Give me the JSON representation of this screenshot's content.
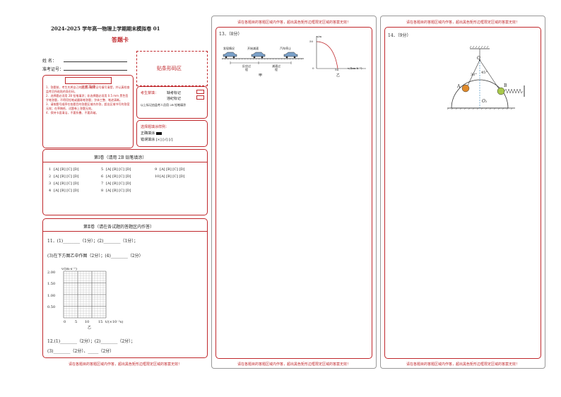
{
  "header": {
    "title": "2024-2025 学年高一物理上学期期末模拟卷 01",
    "subtitle": "答题卡"
  },
  "candidate": {
    "name_label": "姓 名：",
    "id_label": "准考证号：",
    "barcode_label": "贴条形码区"
  },
  "notes": {
    "title": "注意事项",
    "items": [
      "1．答题前，考生先将自己的姓名，准考证号填写清楚，并认真检查监考员所粘贴的条形码。",
      "2．选择题必须用 2B 铅笔填涂；非选择题必须用 0.5 mm 黑色签字笔答题，不得用铅笔或圆珠笔答题；字体工整、笔迹清晰。",
      "3．请按题号顺序在各题目的答题区域内作答，超出区域书写的答案无效；在草稿纸、试题卷上答题无效。",
      "4．保持卡面清洁，不要折叠、不要弄破。"
    ]
  },
  "exam_marks": {
    "label": "考生禁填：",
    "absent": "缺考标记",
    "violation": "违纪标记",
    "note": "以上标记由监考人员用 2B 铅笔填涂"
  },
  "fill_example": {
    "title": "选择题填涂样例：",
    "correct": "正确填涂",
    "wrong": "错误填涂",
    "wrong_marks": "[×] [√] [/]"
  },
  "section1": {
    "title": "第Ⅰ卷（请用 2B 铅笔填涂）",
    "options": "[A] [B] [C] [D]",
    "numbers": [
      "1",
      "2",
      "3",
      "4",
      "5",
      "6",
      "7",
      "8",
      "9",
      "10"
    ]
  },
  "section2": {
    "title": "第Ⅱ卷（请在各试题的答题区内作答）",
    "q11_line1": "11．(1)________（1分）；(2)________（1分）；",
    "q11_line2": "(3)在下方图乙中作图（2分）；(4)________（2分）",
    "graph": {
      "ylabel": "v/(m·s⁻¹)",
      "xlabel": "t/(×10⁻²s)",
      "caption": "乙",
      "y_ticks": [
        "2.00",
        "1.50",
        "1.00",
        "0.50"
      ],
      "x_ticks": [
        "0",
        "5",
        "10",
        "15"
      ]
    },
    "q12_line1": "12.(1)________（2分）；(2)________（2分）；",
    "q12_line2": "(3)________（2分）、_____（2分）"
  },
  "q13": {
    "label": "13．（8分）",
    "phases": [
      "发现情况",
      "开始减速",
      "汽车停止"
    ],
    "sub": [
      "反应过程",
      "减速过程"
    ],
    "caption_left": "甲",
    "caption_right": "乙",
    "v_axis": "v/(km·h⁻¹)",
    "s_axis": "s/m",
    "s_val": "50",
    "v_val": "54",
    "origin": "0"
  },
  "q14": {
    "label": "14．（9分）",
    "point_o": "O",
    "point_o1": "O₁",
    "point_a": "A",
    "point_b": "B",
    "angle1": "30°",
    "angle2": "45°"
  },
  "warning": "请在各题目的答题区域内作答，超出黑色矩形边框限定区域的答案无效！",
  "colors": {
    "accent": "#c0282c"
  }
}
